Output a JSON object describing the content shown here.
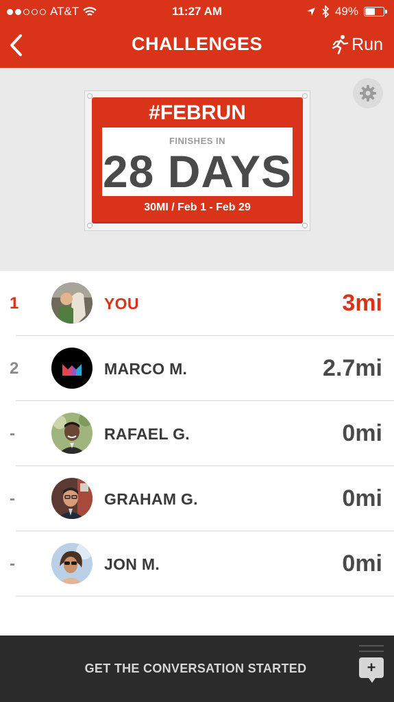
{
  "status_bar": {
    "carrier": "AT&T",
    "time": "11:27 AM",
    "battery": "49%",
    "battery_level": 0.49,
    "signal_bars_filled": 2,
    "signal_bars_total": 5
  },
  "header": {
    "title": "CHALLENGES",
    "run_label": "Run",
    "icons": {
      "back": "chevron-left-icon",
      "run": "runner-icon"
    }
  },
  "challenge": {
    "hashtag": "#FEBRUN",
    "finishes_label": "FINISHES IN",
    "days_left": "28 DAYS",
    "details": "30MI / Feb 1 - Feb 29"
  },
  "leaderboard": [
    {
      "rank": "1",
      "name": "YOU",
      "distance": "3mi",
      "is_me": true
    },
    {
      "rank": "2",
      "name": "MARCO M.",
      "distance": "2.7mi",
      "is_me": false
    },
    {
      "rank": "-",
      "name": "RAFAEL G.",
      "distance": "0mi",
      "is_me": false
    },
    {
      "rank": "-",
      "name": "GRAHAM G.",
      "distance": "0mi",
      "is_me": false
    },
    {
      "rank": "-",
      "name": "JON M.",
      "distance": "0mi",
      "is_me": false
    }
  ],
  "footer": {
    "prompt": "GET THE CONVERSATION STARTED",
    "add_label": "+"
  },
  "colors": {
    "brand": "#d9331a",
    "footer_bg": "#2b2b2b",
    "banner_bg": "#eaeaea"
  }
}
